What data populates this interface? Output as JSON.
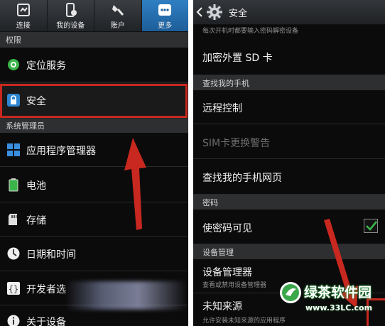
{
  "left": {
    "tabs": [
      {
        "label": "连接",
        "icon": "connections-icon"
      },
      {
        "label": "我的设备",
        "icon": "my-device-icon"
      },
      {
        "label": "账户",
        "icon": "accounts-icon"
      },
      {
        "label": "更多",
        "icon": "more-icon",
        "active": true
      }
    ],
    "section_permissions": "权限",
    "location": "定位服务",
    "security": "安全",
    "section_system": "系统管理员",
    "app_manager": "应用程序管理器",
    "battery": "电池",
    "storage": "存储",
    "datetime": "日期和时间",
    "developer": "开发者选",
    "about": "关于设备"
  },
  "right": {
    "title": "安全",
    "top_note": "每次开机时都要输入密码解密设备",
    "encrypt_sd": "加密外置 SD 卡",
    "section_find": "查找我的手机",
    "remote": "远程控制",
    "sim_alert": "SIM卡更换警告",
    "find_web": "查找我的手机网页",
    "section_password": "密码",
    "show_password": "使密码可见",
    "section_device_admin": "设备管理",
    "device_admins": "设备管理器",
    "device_admins_sub": "查看或禁用设备管理器",
    "unknown_sources": "未知来源",
    "unknown_sources_sub": "允许安装未知来源的应用程序"
  },
  "watermark": {
    "brand": "绿茶软件园",
    "url": "www.33LC.com"
  },
  "colors": {
    "accent_blue": "#2f7fc3",
    "highlight_red": "#c8281f",
    "check_green": "#3bb54a"
  }
}
